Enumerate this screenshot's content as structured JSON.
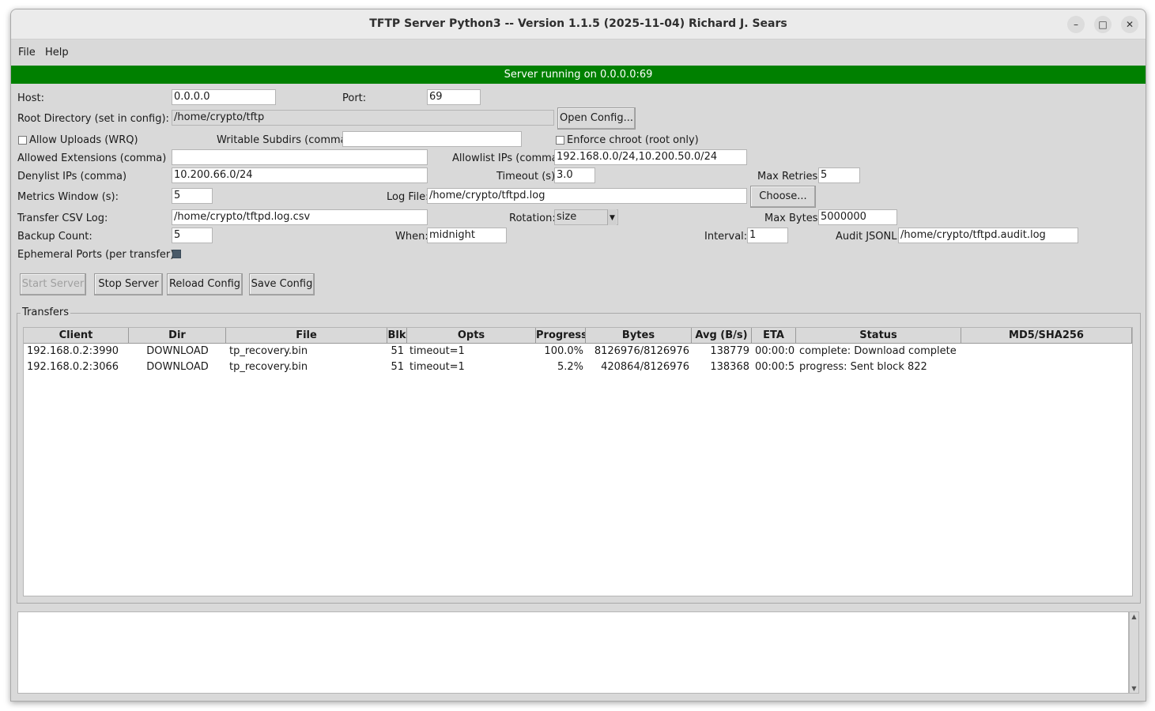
{
  "window": {
    "title": "TFTP Server Python3 -- Version 1.1.5 (2025-11-04) Richard J. Sears",
    "controls": {
      "minimize": "–",
      "maximize": "□",
      "close": "✕"
    }
  },
  "menu": {
    "file": "File",
    "help": "Help"
  },
  "status": {
    "text": "Server running on 0.0.0.0:69",
    "color": "#008000"
  },
  "form": {
    "host_label": "Host:",
    "host_value": "0.0.0.0",
    "port_label": "Port:",
    "port_value": "69",
    "root_label": "Root Directory (set in config):",
    "root_value": "/home/crypto/tftp",
    "open_config_label": "Open Config...",
    "allow_uploads_label": "Allow Uploads (WRQ)",
    "writable_subdirs_label": "Writable Subdirs (comma)",
    "writable_subdirs_value": "",
    "enforce_chroot_label": "Enforce chroot (root only)",
    "allowed_ext_label": "Allowed Extensions (comma)",
    "allowed_ext_value": "",
    "allowlist_label": "Allowlist IPs (comma)",
    "allowlist_value": "192.168.0.0/24,10.200.50.0/24",
    "denylist_label": "Denylist IPs (comma)",
    "denylist_value": "10.200.66.0/24",
    "timeout_label": "Timeout (s):",
    "timeout_value": "3.0",
    "max_retries_label": "Max Retries:",
    "max_retries_value": "5",
    "metrics_label": "Metrics Window (s):",
    "metrics_value": "5",
    "log_file_label": "Log File:",
    "log_file_value": "/home/crypto/tftpd.log",
    "choose_label": "Choose...",
    "csv_label": "Transfer CSV Log:",
    "csv_value": "/home/crypto/tftpd.log.csv",
    "rotation_label": "Rotation:",
    "rotation_value": "size",
    "max_bytes_label": "Max Bytes:",
    "max_bytes_value": "5000000",
    "backup_label": "Backup Count:",
    "backup_value": "5",
    "when_label": "When:",
    "when_value": "midnight",
    "interval_label": "Interval:",
    "interval_value": "1",
    "audit_label": "Audit JSONL:",
    "audit_value": "/home/crypto/tftpd.audit.log",
    "ephemeral_label": "Ephemeral Ports (per transfer):"
  },
  "buttons": {
    "start": "Start Server",
    "stop": "Stop Server",
    "reload": "Reload Config",
    "save": "Save Config"
  },
  "transfers": {
    "title": "Transfers",
    "columns": [
      "Client",
      "Dir",
      "File",
      "Blk",
      "Opts",
      "Progress",
      "Bytes",
      "Avg (B/s)",
      "ETA",
      "Status",
      "MD5/SHA256"
    ],
    "rows": [
      [
        "192.168.0.2:3990",
        "DOWNLOAD",
        "tp_recovery.bin",
        "51",
        "timeout=1",
        "100.0%",
        "8126976/8126976",
        "138779",
        "00:00:0",
        "complete: Download complete",
        ""
      ],
      [
        "192.168.0.2:3066",
        "DOWNLOAD",
        "tp_recovery.bin",
        "51",
        "timeout=1",
        "5.2%",
        "420864/8126976",
        "138368",
        "00:00:5",
        "progress: Sent block 822",
        ""
      ]
    ]
  },
  "log": {
    "text": ""
  }
}
